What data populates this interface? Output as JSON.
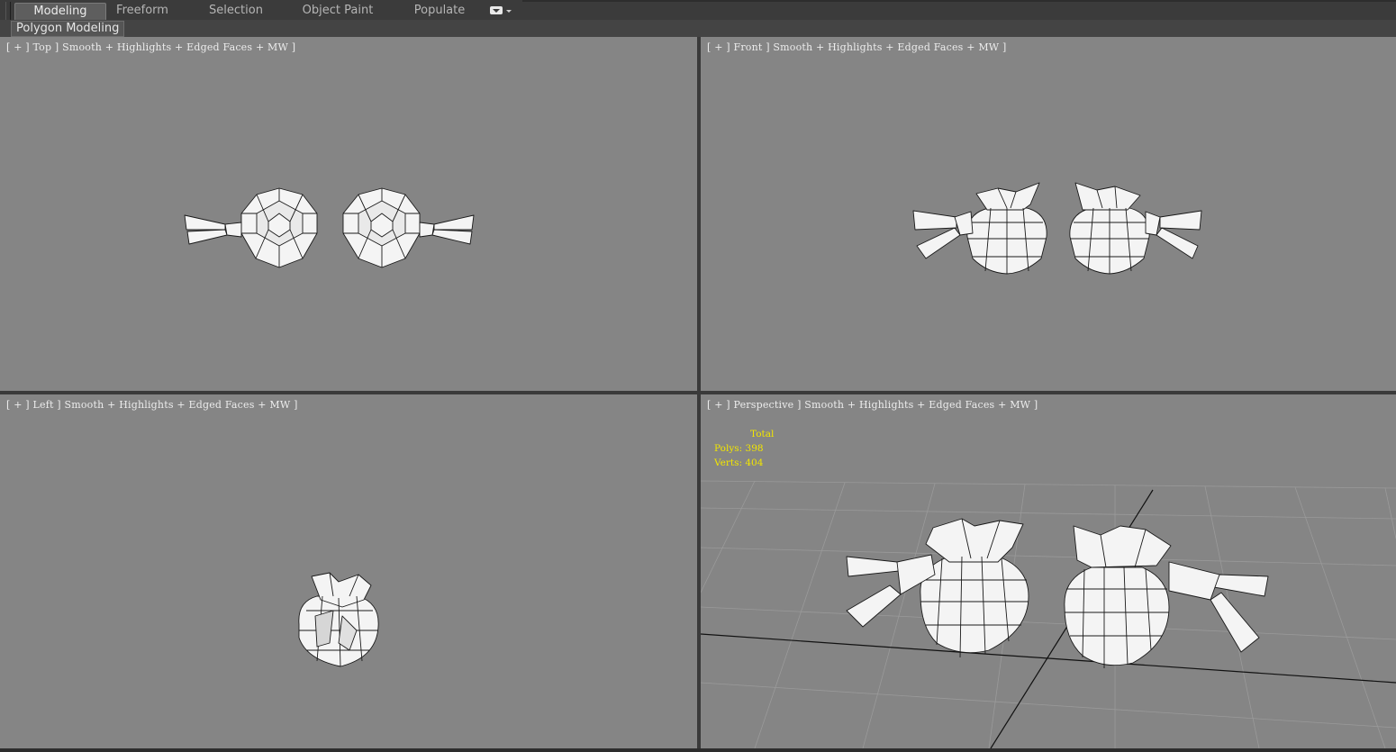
{
  "ribbon": {
    "tabs": [
      {
        "label": "Modeling",
        "active": true
      },
      {
        "label": "Freeform",
        "active": false
      },
      {
        "label": "Selection",
        "active": false
      },
      {
        "label": "Object Paint",
        "active": false
      },
      {
        "label": "Populate",
        "active": false
      }
    ],
    "more_icon": "dropdown-icon",
    "panel_label": "Polygon Modeling"
  },
  "viewports": {
    "top": {
      "label": "[ + ] Top ] Smooth + Highlights + Edged Faces + MW ]"
    },
    "front": {
      "label": "[ + ] Front ] Smooth + Highlights + Edged Faces + MW ]"
    },
    "left": {
      "label": "[ + ] Left ] Smooth + Highlights + Edged Faces + MW ]"
    },
    "perspective": {
      "label": "[ + ] Perspective ] Smooth + Highlights + Edged Faces + MW ]",
      "stats": {
        "title": "Total",
        "polys_label": "Polys:",
        "polys_value": "398",
        "verts_label": "Verts:",
        "verts_value": "404"
      }
    }
  },
  "colors": {
    "viewport_bg": "#858585",
    "stats_text": "#f2e600",
    "mesh_fill": "#f4f4f4",
    "mesh_edge": "#1a1a1a"
  }
}
